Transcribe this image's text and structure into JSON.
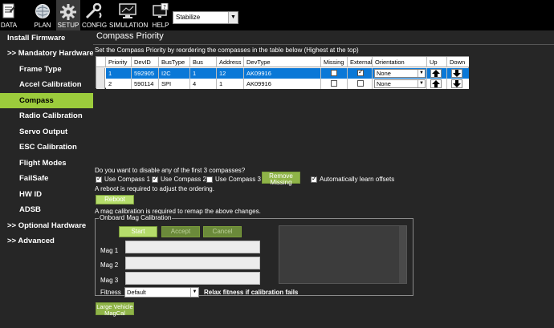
{
  "toolbar": {
    "data_label": "DATA",
    "plan_label": "PLAN",
    "setup_label": "SETUP",
    "config_label": "CONFIG",
    "simulation_label": "SIMULATION",
    "help_label": "HELP",
    "mode_value": "Stabilize"
  },
  "sidebar": {
    "items": [
      {
        "label": "Install Firmware"
      },
      {
        "label": ">> Mandatory Hardware"
      },
      {
        "label": "Frame Type"
      },
      {
        "label": "Accel Calibration"
      },
      {
        "label": "Compass"
      },
      {
        "label": "Radio Calibration"
      },
      {
        "label": "Servo Output"
      },
      {
        "label": "ESC Calibration"
      },
      {
        "label": "Flight Modes"
      },
      {
        "label": "FailSafe"
      },
      {
        "label": "HW ID"
      },
      {
        "label": "ADSB"
      },
      {
        "label": ">> Optional Hardware"
      },
      {
        "label": ">> Advanced"
      }
    ]
  },
  "main": {
    "title": "Compass Priority",
    "instructions": "Set the Compass Priority by reordering the compasses in the table below (Highest at the top)"
  },
  "table": {
    "columns": [
      "Priority",
      "DevID",
      "BusType",
      "Bus",
      "Address",
      "DevType",
      "Missing",
      "External",
      "Orientation",
      "Up",
      "Down"
    ],
    "rows": [
      {
        "priority": "1",
        "devid": "592905",
        "bustype": "I2C",
        "bus": "1",
        "address": "12",
        "devtype": "AK09916",
        "missing": false,
        "external": true,
        "orientation": "None"
      },
      {
        "priority": "2",
        "devid": "590114",
        "bustype": "SPI",
        "bus": "4",
        "address": "1",
        "devtype": "AK09916",
        "missing": false,
        "external": false,
        "orientation": "None"
      }
    ]
  },
  "disable": {
    "question": "Do you want to disable any of the first 3 compasses?",
    "use1": "Use Compass 1",
    "use2": "Use Compass 2",
    "use3": "Use Compass 3",
    "use1_checked": true,
    "use2_checked": true,
    "use3_checked": false,
    "remove_missing": "Remove Missing",
    "auto_learn": "Automatically learn offsets",
    "auto_learn_checked": true,
    "reboot_note": "A reboot is required to adjust the ordering.",
    "reboot_button": "Reboot",
    "mag_note": "A mag calibration is required to remap the above changes."
  },
  "calibration": {
    "group_title": "Onboard Mag Calibration",
    "start": "Start",
    "accept": "Accept",
    "cancel": "Cancel",
    "mag1": "Mag 1",
    "mag2": "Mag 2",
    "mag3": "Mag 3",
    "fitness_label": "Fitness",
    "fitness_value": "Default",
    "relax": "Relax fitness if calibration fails",
    "large_vehicle": "Large Vehicle MagCal"
  },
  "colors": {
    "accent": "#9ccc3c",
    "selected_row": "#0a78d7",
    "background": "#262626"
  }
}
